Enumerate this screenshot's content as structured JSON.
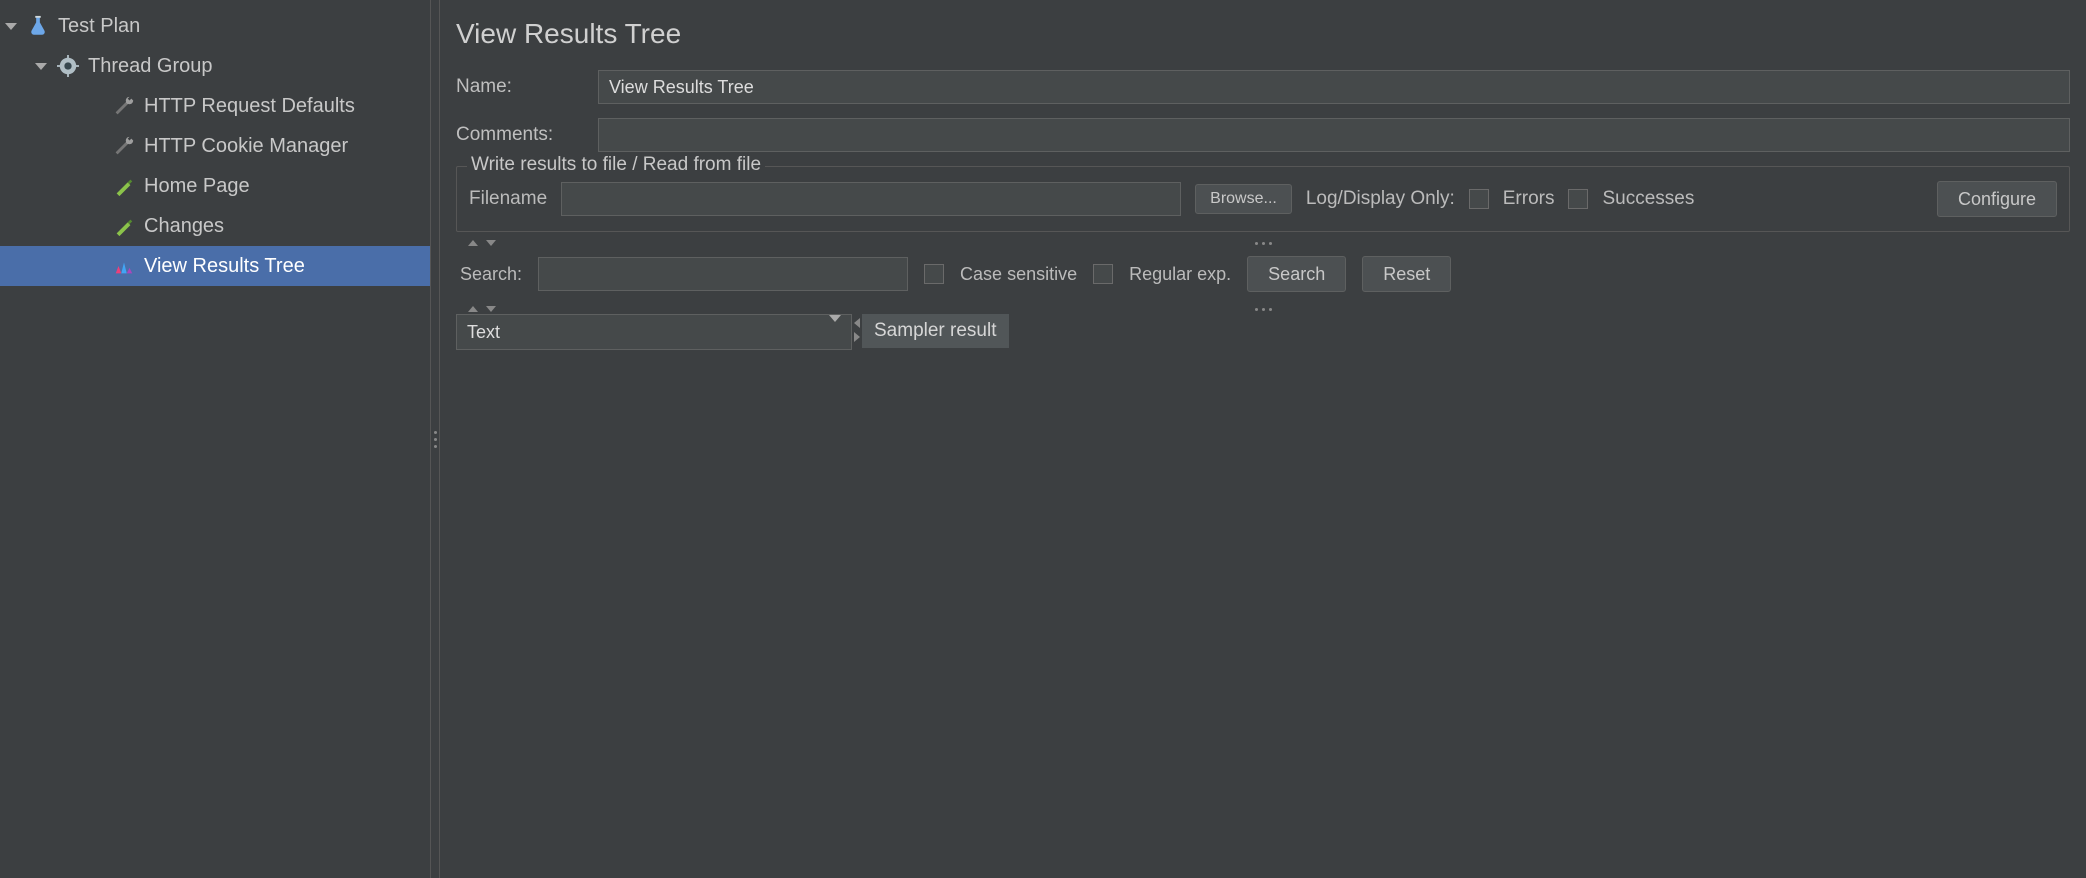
{
  "tree": {
    "testPlan": "Test Plan",
    "threadGroup": "Thread Group",
    "httpDefaults": "HTTP Request Defaults",
    "cookieManager": "HTTP Cookie Manager",
    "homePage": "Home Page",
    "changes": "Changes",
    "viewResults": "View Results Tree"
  },
  "panel": {
    "title": "View Results Tree",
    "nameLabel": "Name:",
    "nameValue": "View Results Tree",
    "commentsLabel": "Comments:",
    "commentsValue": "",
    "fieldsetLegend": "Write results to file / Read from file",
    "filenameLabel": "Filename",
    "filenameValue": "",
    "browseLabel": "Browse...",
    "logDisplayLabel": "Log/Display Only:",
    "errorsLabel": "Errors",
    "successesLabel": "Successes",
    "configureLabel": "Configure",
    "searchLabel": "Search:",
    "searchValue": "",
    "caseSensitiveLabel": "Case sensitive",
    "regexLabel": "Regular exp.",
    "searchBtn": "Search",
    "resetBtn": "Reset",
    "rendererValue": "Text",
    "samplerTab": "Sampler result"
  }
}
